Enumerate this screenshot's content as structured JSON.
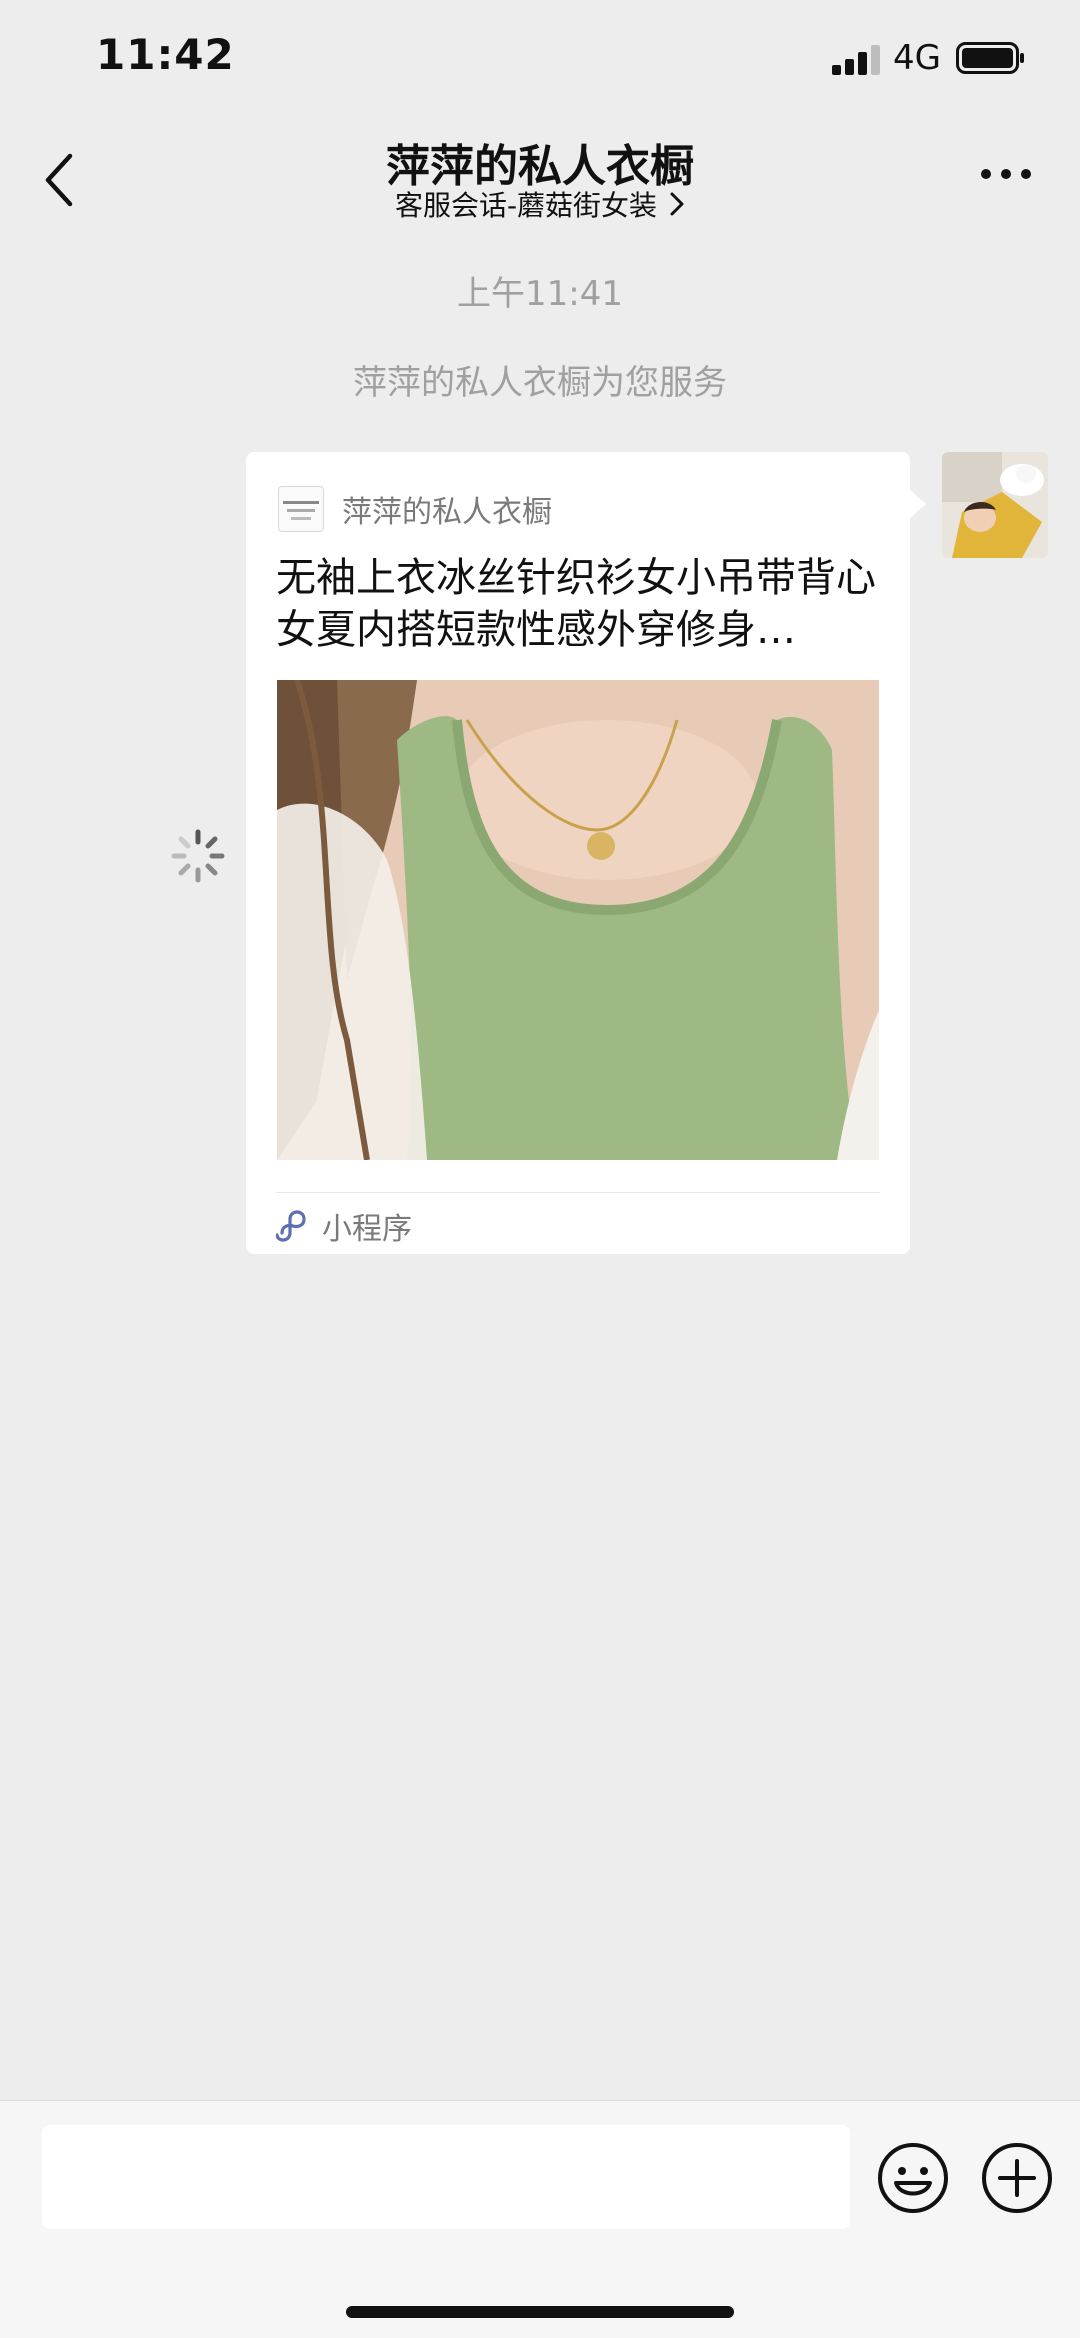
{
  "status_bar": {
    "time": "11:42",
    "network": "4G",
    "battery_level": 0.9
  },
  "header": {
    "title": "萍萍的私人衣橱",
    "subtitle": "客服会话-蘑菇街女装",
    "back_icon": "chevron-left-icon",
    "more_icon": "more-dots-icon"
  },
  "chat": {
    "time_label": "上午11:41",
    "notice": "萍萍的私人衣橱为您服务",
    "message": {
      "status": "sending",
      "card": {
        "shop_name": "萍萍的私人衣橱",
        "product_title": "无袖上衣冰丝针织衫女小吊带背心女夏内搭短款性感外穿修身…",
        "source_label": "小程序",
        "source_icon": "mini-program-icon"
      }
    }
  },
  "input_bar": {
    "placeholder": "",
    "emoji_icon": "emoji-icon",
    "plus_icon": "plus-icon"
  }
}
